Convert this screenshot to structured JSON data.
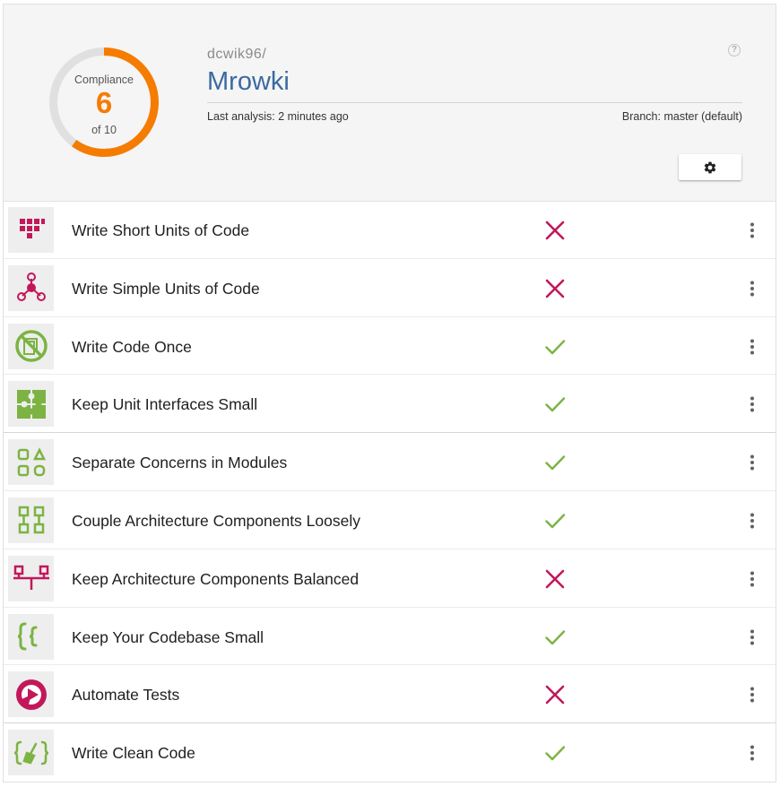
{
  "compliance": {
    "label": "Compliance",
    "score": "6",
    "of_text": "of 10",
    "score_fraction": 0.6
  },
  "repository": {
    "owner": "dcwik96/",
    "name": "Mrowki",
    "last_analysis": "Last analysis: 2 minutes ago",
    "branch": "Branch: master (default)"
  },
  "help_icon": "?",
  "colors": {
    "accent": "#f57c00",
    "pass": "#7cb342",
    "fail": "#c2185b",
    "repo_link": "#3b6aa0",
    "gauge_track": "#e0e0e0"
  },
  "guidelines": [
    {
      "label": "Write Short Units of Code",
      "status": "fail",
      "icon": "short-units-icon"
    },
    {
      "label": "Write Simple Units of Code",
      "status": "fail",
      "icon": "simple-units-icon"
    },
    {
      "label": "Write Code Once",
      "status": "pass",
      "icon": "code-once-icon"
    },
    {
      "label": "Keep Unit Interfaces Small",
      "status": "pass",
      "icon": "puzzle-icon"
    },
    {
      "label": "Separate Concerns in Modules",
      "status": "pass",
      "icon": "modules-icon"
    },
    {
      "label": "Couple Architecture Components Loosely",
      "status": "pass",
      "icon": "components-icon"
    },
    {
      "label": "Keep Architecture Components Balanced",
      "status": "fail",
      "icon": "balance-icon"
    },
    {
      "label": "Keep Your Codebase Small",
      "status": "pass",
      "icon": "braces-icon"
    },
    {
      "label": "Automate Tests",
      "status": "fail",
      "icon": "play-icon"
    },
    {
      "label": "Write Clean Code",
      "status": "pass",
      "icon": "broom-braces-icon"
    }
  ]
}
